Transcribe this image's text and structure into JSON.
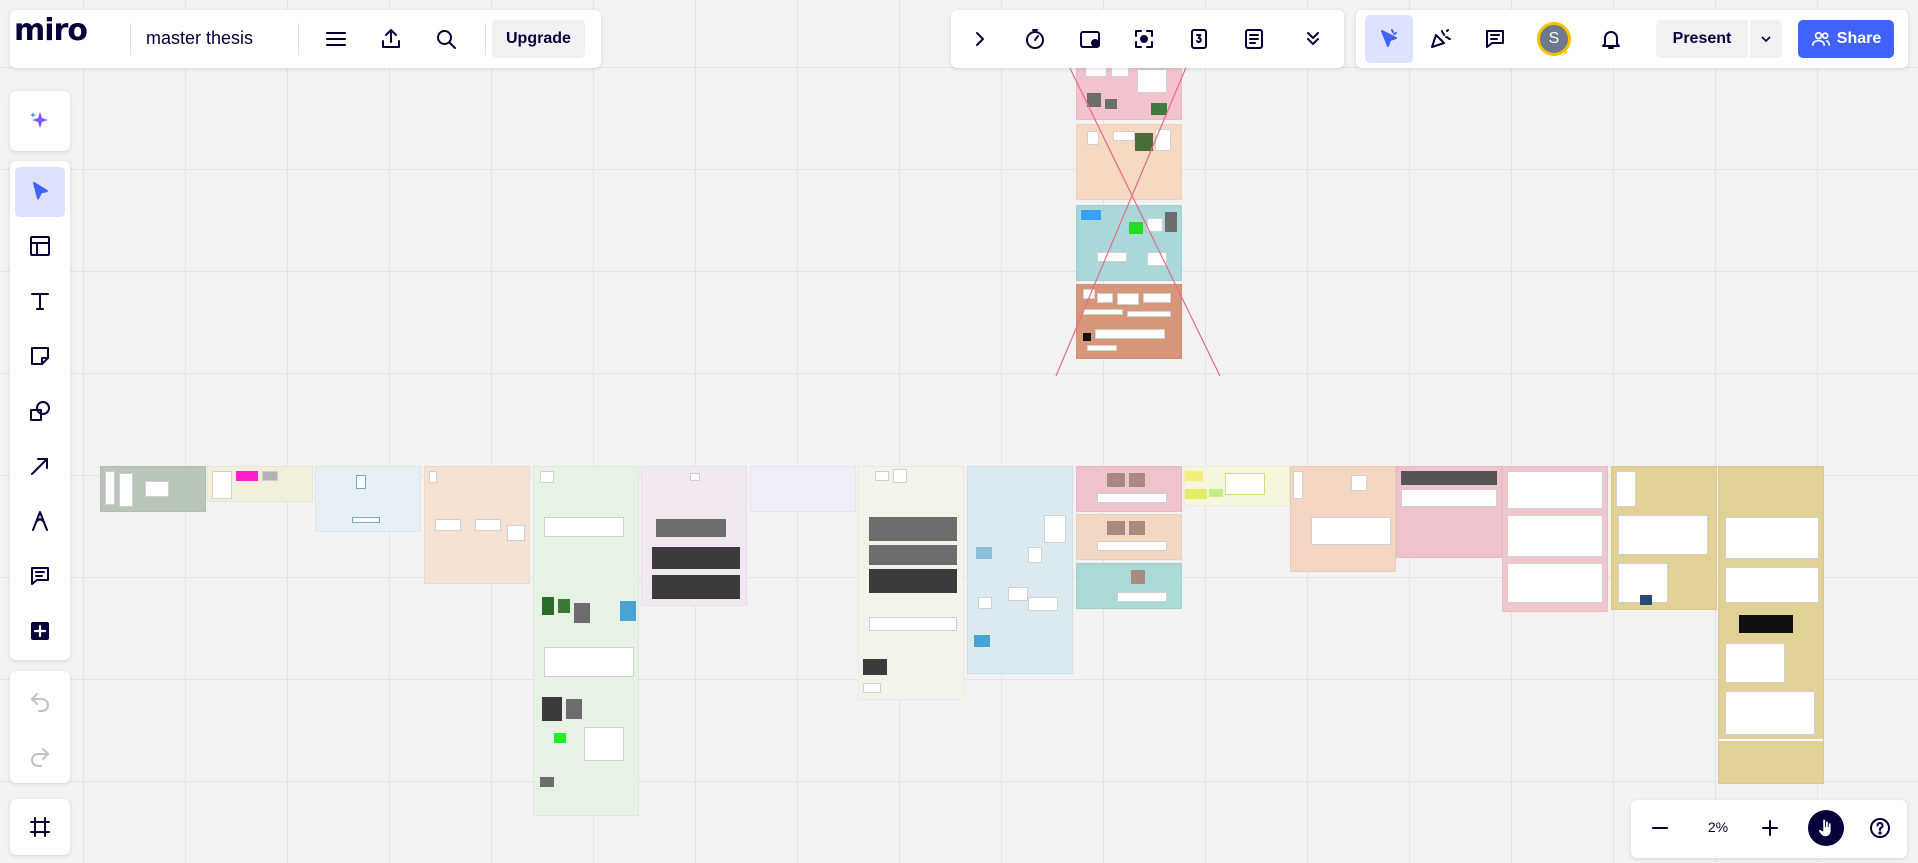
{
  "app": {
    "logo": "miro",
    "board_title": "master thesis"
  },
  "toolbar": {
    "upgrade_label": "Upgrade"
  },
  "collab": {
    "avatar_initial": "S",
    "present_label": "Present",
    "share_label": "Share"
  },
  "zoom": {
    "level": "2%"
  },
  "colors": {
    "accent": "#4262ff",
    "accent_light": "#dde3ff",
    "text": "#050038",
    "canvas": "#f2f2f2",
    "avatar_ring": "#f5c300"
  },
  "icons": {
    "left_toolbar": [
      "sparkle-icon",
      "select-cursor-icon",
      "templates-icon",
      "text-icon",
      "sticky-note-icon",
      "shapes-icon",
      "arrow-line-icon",
      "pen-icon",
      "comment-icon",
      "add-plus-icon",
      "undo-icon",
      "redo-icon",
      "frames-icon"
    ],
    "center_toolbar": [
      "chevron-right-icon",
      "timer-icon",
      "video-camera-icon",
      "focus-frame-icon",
      "number-counter-icon",
      "notes-icon",
      "chevron-double-down-icon"
    ],
    "right_toolbar": [
      "reactions-cursor-icon",
      "celebrate-icon",
      "comments-icon",
      "bell-icon",
      "chevron-down-icon",
      "share-users-icon"
    ],
    "bottom_right": [
      "minus-icon",
      "plus-icon",
      "hand-pointer-icon",
      "help-icon"
    ]
  }
}
